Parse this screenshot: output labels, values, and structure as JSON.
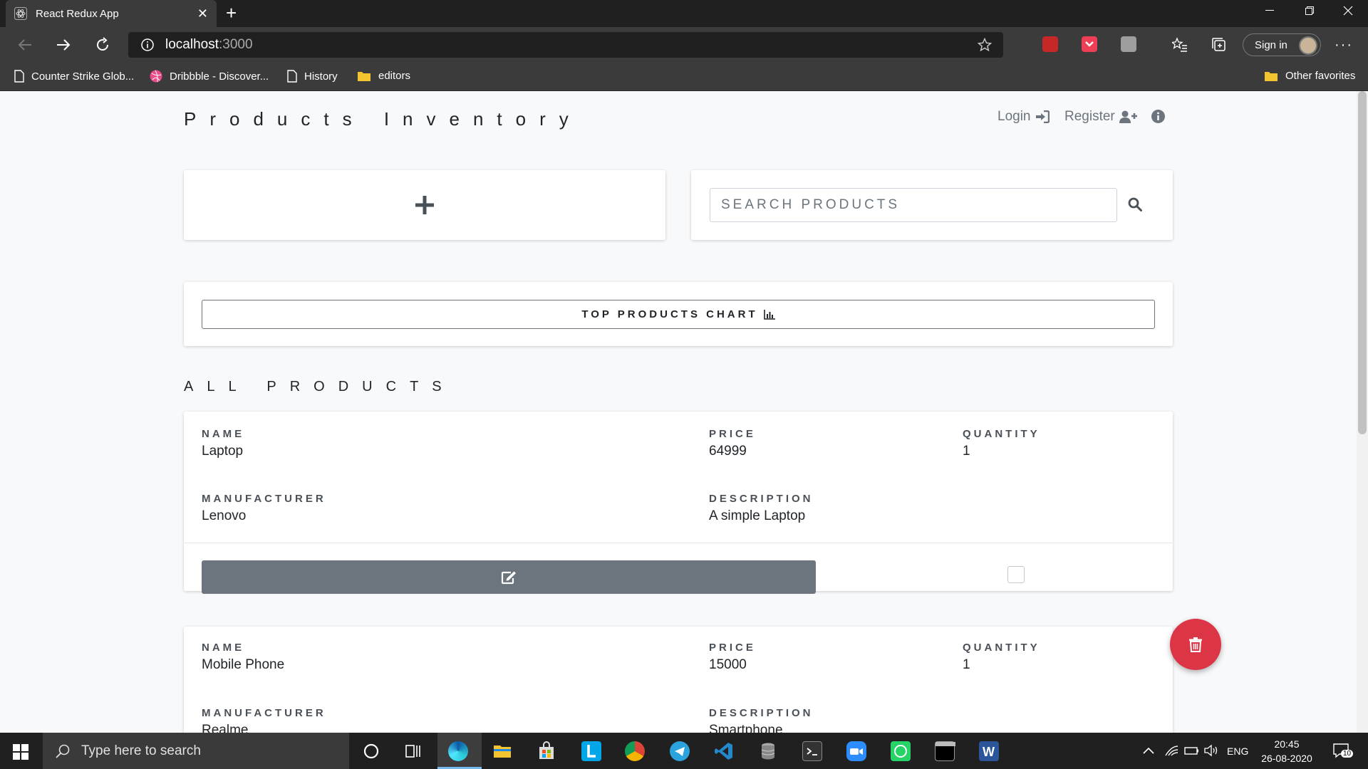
{
  "browser": {
    "tab_title": "React Redux App",
    "url_host": "localhost",
    "url_port": ":3000",
    "signin_label": "Sign in",
    "bookmarks": [
      "Counter Strike Glob...",
      "Dribbble - Discover...",
      "History",
      "editors"
    ],
    "other_favorites": "Other favorites"
  },
  "header": {
    "brand": "Products Inventory",
    "login": "Login",
    "register": "Register"
  },
  "search": {
    "placeholder": "SEARCH PRODUCTS"
  },
  "chart_button": "TOP PRODUCTS CHART",
  "section_title": "ALL PRODUCTS",
  "labels": {
    "name": "NAME",
    "price": "PRICE",
    "quantity": "QUANTITY",
    "manufacturer": "MANUFACTURER",
    "description": "DESCRIPTION"
  },
  "products": [
    {
      "name": "Laptop",
      "price": "64999",
      "quantity": "1",
      "manufacturer": "Lenovo",
      "description": "A simple Laptop"
    },
    {
      "name": "Mobile Phone",
      "price": "15000",
      "quantity": "1",
      "manufacturer": "Realme",
      "description": "Smartphone"
    }
  ],
  "taskbar": {
    "search_placeholder": "Type here to search",
    "language": "ENG",
    "time": "20:45",
    "date": "26-08-2020",
    "notification_count": "10"
  },
  "colors": {
    "danger": "#dc3545",
    "secondary": "#6c757d",
    "edge_accent": "#76b9ed"
  }
}
